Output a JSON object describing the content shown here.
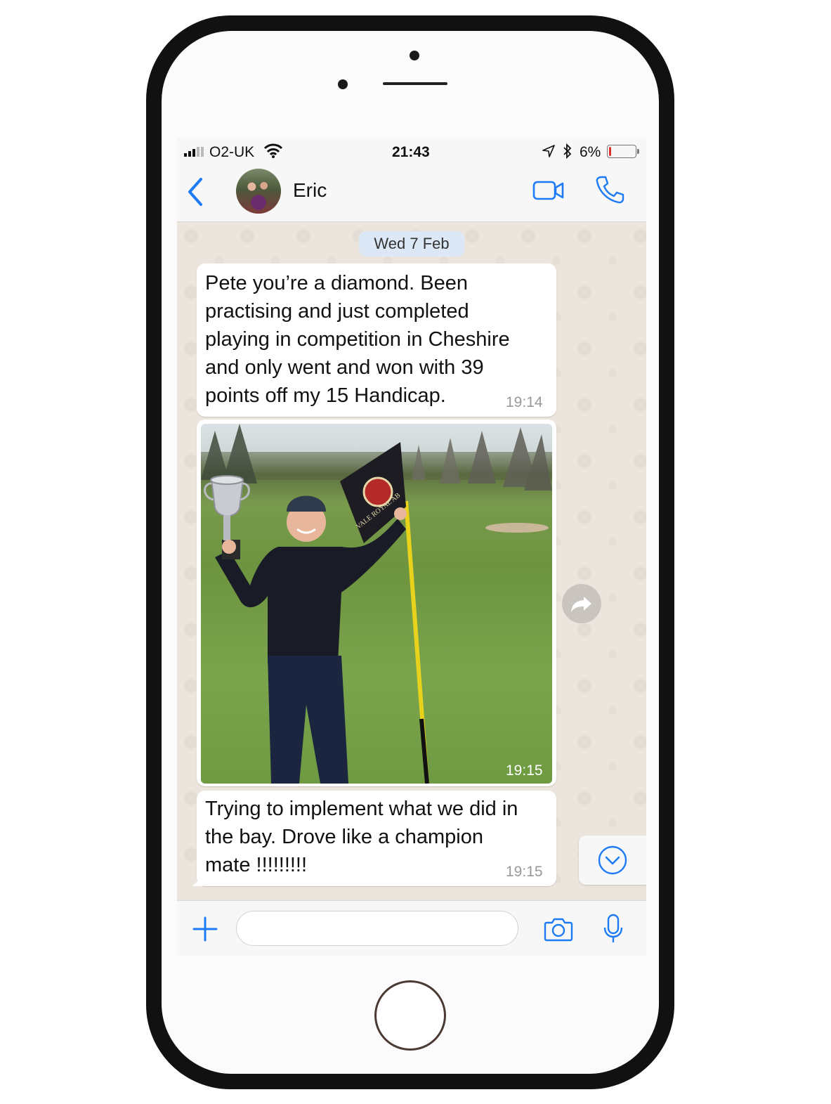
{
  "status_bar": {
    "carrier": "O2-UK",
    "time": "21:43",
    "battery_percent": "6%",
    "battery_level": 0.06,
    "icons": [
      "signal-icon",
      "wifi-icon",
      "location-arrow-icon",
      "bluetooth-icon",
      "battery-icon"
    ]
  },
  "header": {
    "contact_name": "Eric",
    "icons": [
      "back-chevron-icon",
      "video-call-icon",
      "phone-call-icon"
    ]
  },
  "chat": {
    "date_label": "Wed 7 Feb",
    "messages": [
      {
        "type": "text",
        "lines": [
          "Pete you’re a diamond. Been",
          "practising and just completed",
          "playing in competition in Cheshire",
          "and only went and won with 39",
          "points off my 15 Handicap."
        ],
        "time": "19:14"
      },
      {
        "type": "image",
        "image_text": "VALE ROYAL AB",
        "time": "19:15"
      },
      {
        "type": "text",
        "lines": [
          "Trying to implement what we did in",
          "the bay. Drove like a champion",
          "mate !!!!!!!!!"
        ],
        "time": "19:15"
      }
    ]
  },
  "composer": {
    "input_value": "",
    "icons": [
      "plus-icon",
      "camera-icon",
      "microphone-icon"
    ]
  },
  "colors": {
    "accent": "#1d7bf5",
    "chat_background": "#ece5dd",
    "bubble": "#ffffff",
    "date_pill": "#dde8f6"
  }
}
